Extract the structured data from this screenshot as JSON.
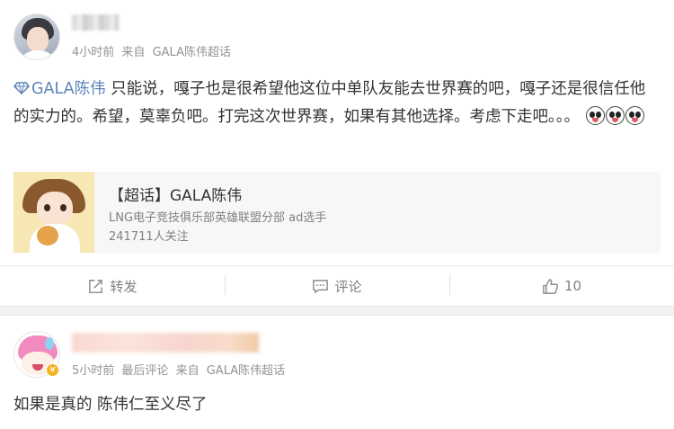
{
  "post1": {
    "time": "4小时前",
    "source_prefix": "来自",
    "source": "GALA陈伟超话",
    "topic_link": "GALA陈伟",
    "body": " 只能说，嘎子也是很希望他这位中单队友能去世界赛的吧，嘎子还是很信任他的实力的。希望，莫辜负吧。打完这次世界赛，如果有其他选择。考虑下走吧。。。",
    "emojis": [
      "doge-emoji",
      "doge-emoji",
      "doge-emoji"
    ],
    "card": {
      "title": "【超话】GALA陈伟",
      "subtitle": "LNG电子竞技俱乐部英雄联盟分部 ad选手",
      "followers": "241711人关注"
    },
    "actions": {
      "repost_label": "转发",
      "comment_label": "评论",
      "like_count": "10"
    }
  },
  "post2": {
    "time": "5小时前",
    "last_comment": "最后评论",
    "source_prefix": "来自",
    "source": "GALA陈伟超话",
    "body": "如果是真的 陈伟仁至义尽了"
  },
  "colors": {
    "link": "#5d83b8",
    "meta": "#939393",
    "badge": "#f5b320"
  }
}
